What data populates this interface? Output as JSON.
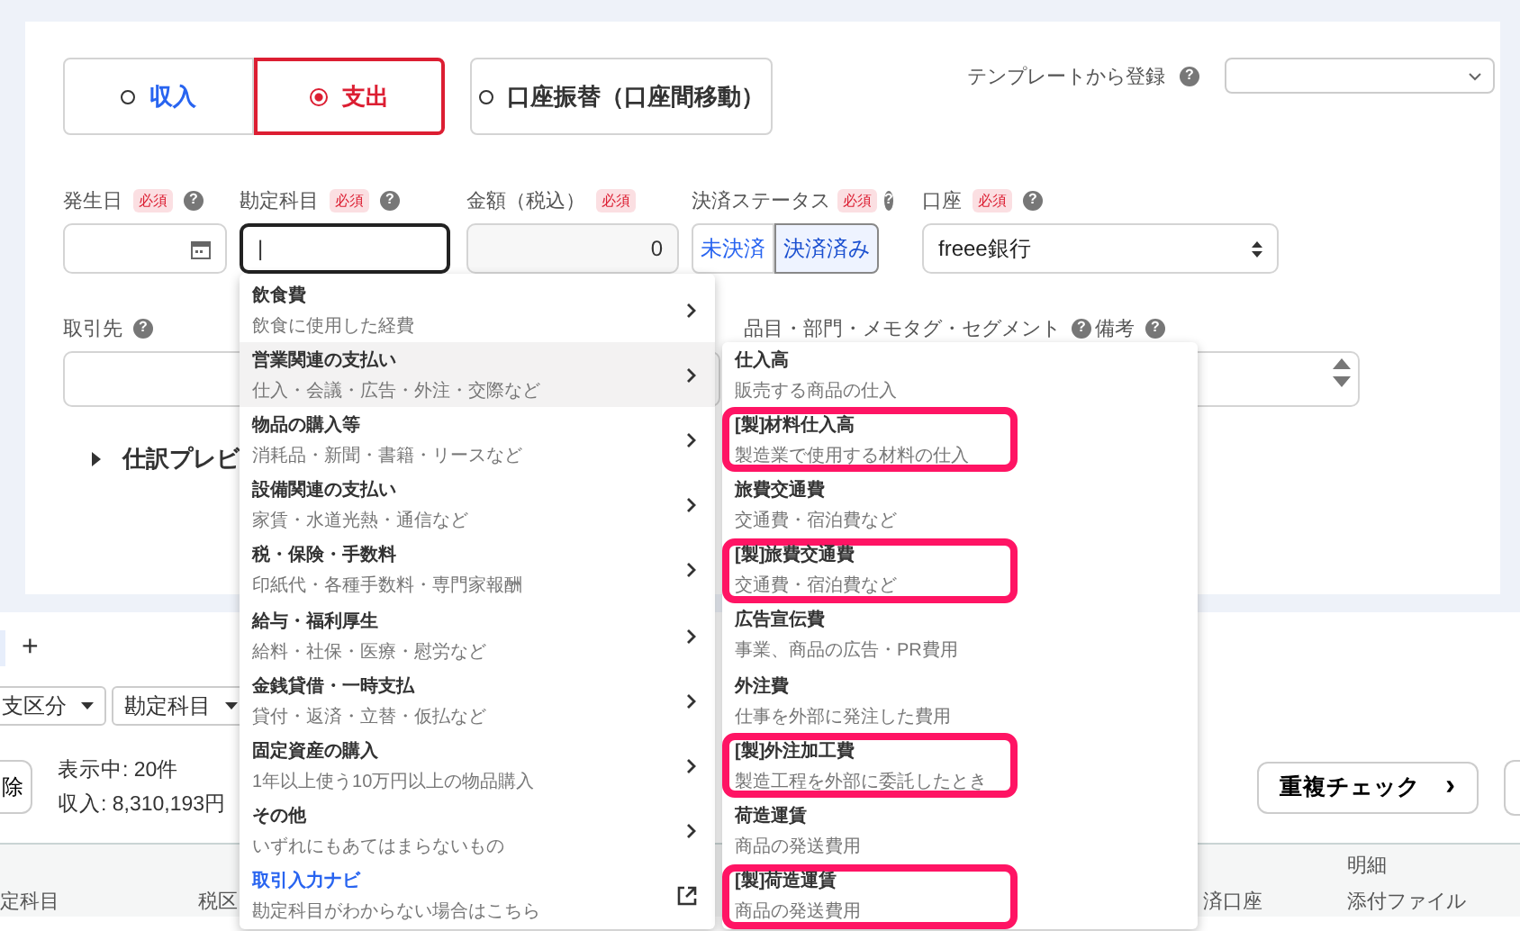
{
  "type_toggle": [
    {
      "label": "収入",
      "selected": false
    },
    {
      "label": "支出",
      "selected": true
    },
    {
      "label": "口座振替（口座間移動）",
      "selected": false
    }
  ],
  "template": {
    "label": "テンプレートから登録",
    "help": "?"
  },
  "fields": [
    {
      "label": "発生日",
      "required": "必須",
      "help": "?",
      "kind": "date"
    },
    {
      "label": "勘定科目",
      "required": "必須",
      "help": "?",
      "kind": "text",
      "focused": true,
      "value": "|"
    },
    {
      "label": "金額（税込）",
      "required": "必須",
      "kind": "amount",
      "value": "0"
    },
    {
      "label": "決済ステータス",
      "required": "必須",
      "help": "?",
      "kind": "status",
      "options": [
        {
          "label": "未決済",
          "selected": false
        },
        {
          "label": "決済済み",
          "selected": true
        }
      ]
    },
    {
      "label": "口座",
      "required": "必須",
      "help": "?",
      "kind": "select",
      "value": "freee銀行"
    }
  ],
  "row2": {
    "partner_label": "取引先",
    "partner_help": "?",
    "tags_label": "品目・部門・メモタグ・セグメント",
    "tags_help": "?",
    "memo_label": "備考",
    "memo_help": "?"
  },
  "preview_toggle": {
    "label": "仕訳プレビ",
    "expanded": false
  },
  "account_menu": [
    {
      "title": "飲食費",
      "desc": "飲食に使用した経費",
      "hovered": false,
      "kind": "category"
    },
    {
      "title": "営業関連の支払い",
      "desc": "仕入・会議・広告・外注・交際など",
      "hovered": true,
      "kind": "category"
    },
    {
      "title": "物品の購入等",
      "desc": "消耗品・新聞・書籍・リースなど",
      "hovered": false,
      "kind": "category"
    },
    {
      "title": "設備関連の支払い",
      "desc": "家賃・水道光熱・通信など",
      "hovered": false,
      "kind": "category"
    },
    {
      "title": "税・保険・手数料",
      "desc": "印紙代・各種手数料・専門家報酬",
      "hovered": false,
      "kind": "category"
    },
    {
      "title": "給与・福利厚生",
      "desc": "給料・社保・医療・慰労など",
      "hovered": false,
      "kind": "category"
    },
    {
      "title": "金銭貸借・一時支払",
      "desc": "貸付・返済・立替・仮払など",
      "hovered": false,
      "kind": "category"
    },
    {
      "title": "固定資産の購入",
      "desc": "1年以上使う10万円以上の物品購入",
      "hovered": false,
      "kind": "category"
    },
    {
      "title": "その他",
      "desc": "いずれにもあてはまらないもの",
      "hovered": false,
      "kind": "category"
    },
    {
      "title": "取引入力ナビ",
      "desc": "勘定科目がわからない場合はこちら",
      "hovered": false,
      "kind": "external"
    }
  ],
  "sub_menu": [
    {
      "title": "仕入高",
      "desc": "販売する商品の仕入",
      "highlighted": false
    },
    {
      "title": "[製]材料仕入高",
      "desc": "製造業で使用する材料の仕入",
      "highlighted": true
    },
    {
      "title": "旅費交通費",
      "desc": "交通費・宿泊費など",
      "highlighted": false
    },
    {
      "title": "[製]旅費交通費",
      "desc": "交通費・宿泊費など",
      "highlighted": true
    },
    {
      "title": "広告宣伝費",
      "desc": "事業、商品の広告・PR費用",
      "highlighted": false
    },
    {
      "title": "外注費",
      "desc": "仕事を外部に発注した費用",
      "highlighted": false
    },
    {
      "title": "[製]外注加工費",
      "desc": "製造工程を外部に委託したとき",
      "highlighted": true
    },
    {
      "title": "荷造運賃",
      "desc": "商品の発送費用",
      "highlighted": false
    },
    {
      "title": "[製]荷造運賃",
      "desc": "商品の発送費用",
      "highlighted": true
    }
  ],
  "list": {
    "add_tab": "+",
    "filters": [
      "支区分",
      "勘定科目"
    ],
    "clear_button": "除",
    "count": "表示中: 20件",
    "income": "収入: 8,310,193円",
    "duplicate_button": "重複チェック",
    "duplicate_chevron": "›",
    "header_top": [
      "明細"
    ],
    "header_bottom": [
      "定科目",
      "税区",
      "済口座",
      "添付ファイル"
    ]
  }
}
